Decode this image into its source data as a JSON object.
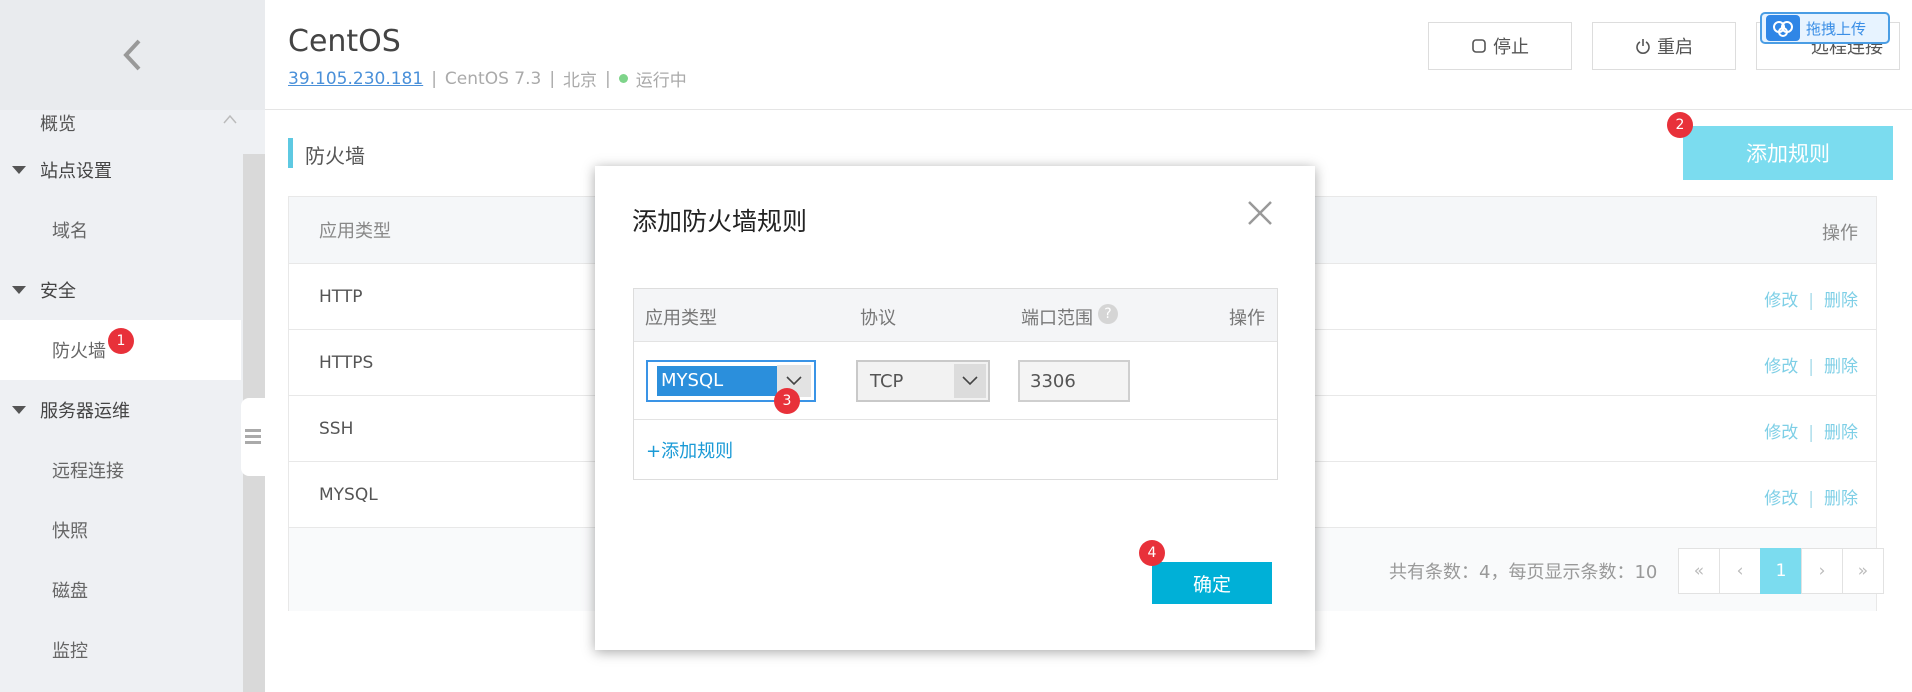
{
  "sidebar": {
    "items": [
      {
        "label": "概览"
      },
      {
        "label": "站点设置"
      },
      {
        "label": "域名"
      },
      {
        "label": "安全"
      },
      {
        "label": "防火墙",
        "badge": "1"
      },
      {
        "label": "服务器运维"
      },
      {
        "label": "远程连接"
      },
      {
        "label": "快照"
      },
      {
        "label": "磁盘"
      },
      {
        "label": "监控"
      }
    ]
  },
  "header": {
    "title": "CentOS",
    "ip": "39.105.230.181",
    "os": "CentOS 7.3",
    "region": "北京",
    "status": "运行中",
    "separator": "|",
    "stop_label": "停止",
    "restart_label": "重启",
    "remote_label": "远程连接",
    "upload_label": "拖拽上传"
  },
  "firewall": {
    "title": "防火墙",
    "add_rule_label": "添加规则",
    "add_rule_badge": "2",
    "columns": {
      "type": "应用类型",
      "ops": "操作"
    },
    "rows": [
      {
        "type": "HTTP"
      },
      {
        "type": "HTTPS"
      },
      {
        "type": "SSH"
      },
      {
        "type": "MYSQL"
      }
    ],
    "edit_label": "修改",
    "delete_label": "删除",
    "action_sep": "|",
    "total_text": "共有条数：4，每页显示条数：10",
    "pager": {
      "first": "«",
      "prev": "‹",
      "current": "1",
      "next": "›",
      "last": "»"
    }
  },
  "modal": {
    "title": "添加防火墙规则",
    "columns": {
      "type": "应用类型",
      "protocol": "协议",
      "port": "端口范围",
      "ops": "操作",
      "help": "?"
    },
    "type_value": "MYSQL",
    "type_badge": "3",
    "protocol_value": "TCP",
    "port_value": "3306",
    "add_rule_link": "+添加规则",
    "confirm_label": "确定",
    "confirm_badge": "4"
  },
  "colors": {
    "accent": "#00b0d7",
    "badge": "#e8313a",
    "link": "#4a90d9"
  }
}
